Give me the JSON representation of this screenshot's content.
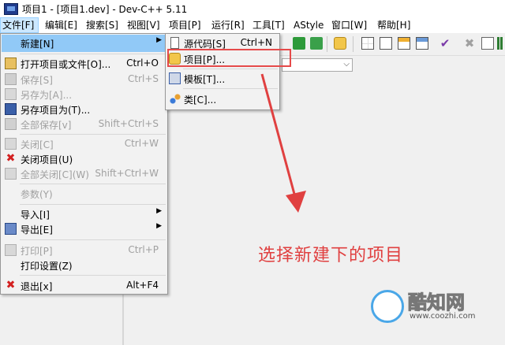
{
  "window": {
    "title": "项目1 - [项目1.dev] - Dev-C++ 5.11"
  },
  "menubar": {
    "items": [
      {
        "label": "文件[F]"
      },
      {
        "label": "编辑[E]"
      },
      {
        "label": "搜索[S]"
      },
      {
        "label": "视图[V]"
      },
      {
        "label": "项目[P]"
      },
      {
        "label": "运行[R]"
      },
      {
        "label": "工具[T]"
      },
      {
        "label": "AStyle"
      },
      {
        "label": "窗口[W]"
      },
      {
        "label": "帮助[H]"
      }
    ]
  },
  "file_menu": {
    "items": [
      {
        "label": "新建[N]",
        "shortcut": "",
        "has_submenu": true,
        "enabled": true,
        "highlighted": true,
        "icon": ""
      },
      {
        "label": "打开项目或文件[O]...",
        "shortcut": "Ctrl+O",
        "enabled": true,
        "icon": "open-folder-icon"
      },
      {
        "label": "保存[S]",
        "shortcut": "Ctrl+S",
        "enabled": false,
        "icon": "save-icon"
      },
      {
        "label": "另存为[A]...",
        "shortcut": "",
        "enabled": false,
        "icon": "save-as-icon"
      },
      {
        "label": "另存项目为(T)...",
        "shortcut": "",
        "enabled": true,
        "icon": "save-project-icon"
      },
      {
        "label": "全部保存[v]",
        "shortcut": "Shift+Ctrl+S",
        "enabled": false,
        "icon": "save-all-icon"
      },
      {
        "label": "关闭[C]",
        "shortcut": "Ctrl+W",
        "enabled": false,
        "icon": "close-file-icon"
      },
      {
        "label": "关闭项目(U)",
        "shortcut": "",
        "enabled": true,
        "icon": "red-x-icon"
      },
      {
        "label": "全部关闭[C](W)",
        "shortcut": "Shift+Ctrl+W",
        "enabled": false,
        "icon": "close-all-icon"
      },
      {
        "label": "参数(Y)",
        "shortcut": "",
        "enabled": false,
        "icon": ""
      },
      {
        "label": "导入[I]",
        "shortcut": "",
        "has_submenu": true,
        "enabled": true,
        "icon": ""
      },
      {
        "label": "导出[E]",
        "shortcut": "",
        "has_submenu": true,
        "enabled": true,
        "icon": "export-icon"
      },
      {
        "label": "打印[P]",
        "shortcut": "Ctrl+P",
        "enabled": false,
        "icon": "print-icon"
      },
      {
        "label": "打印设置(Z)",
        "shortcut": "",
        "enabled": true,
        "icon": ""
      },
      {
        "label": "退出[x]",
        "shortcut": "Alt+F4",
        "enabled": true,
        "icon": "exit-icon"
      }
    ]
  },
  "new_submenu": {
    "items": [
      {
        "label": "源代码[S]",
        "shortcut": "Ctrl+N",
        "icon": "source-file-icon"
      },
      {
        "label": "项目[P]...",
        "shortcut": "",
        "icon": "project-icon"
      },
      {
        "label": "模板[T]...",
        "shortcut": "",
        "icon": "template-icon"
      },
      {
        "label": "类[C]...",
        "shortcut": "",
        "icon": "class-icon"
      }
    ]
  },
  "annotation": {
    "text": "选择新建下的项目",
    "color": "#e04040"
  },
  "watermark": {
    "name": "酷知网",
    "url": "www.coozhi.com"
  },
  "colors": {
    "menu_highlight": "#91c9f7",
    "menubar_active": "#cce8ff",
    "highlight_box": "#e64a4a"
  }
}
